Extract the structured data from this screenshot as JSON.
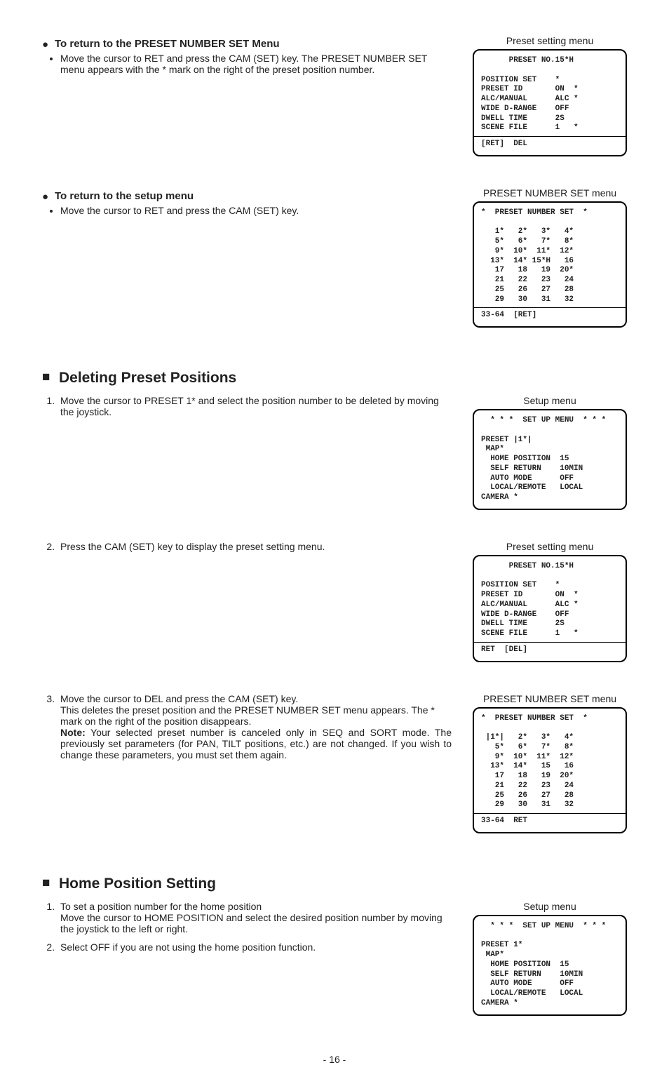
{
  "sections": {
    "return_preset": {
      "heading": "To return to the PRESET NUMBER SET Menu",
      "bullet": "Move the cursor to RET and press the CAM (SET) key. The PRESET NUMBER SET menu appears with the * mark on the right of the preset position number."
    },
    "return_setup": {
      "heading": "To return to the setup menu",
      "bullet": "Move the cursor to RET and press the CAM (SET) key."
    },
    "deleting": {
      "heading": "Deleting Preset Positions",
      "step1": "Move the cursor to PRESET 1* and select the position number to be deleted by moving the joystick.",
      "step2": "Press the CAM (SET) key to display the preset setting menu.",
      "step3a": "Move the cursor to DEL and press the CAM (SET) key.",
      "step3b": "This deletes the preset position and the PRESET NUMBER SET menu appears. The * mark on the right of the position disappears.",
      "note_label": "Note:",
      "note_text": " Your selected preset number is canceled only in SEQ and SORT mode.  The previously set parameters (for PAN, TILT positions, etc.) are not changed.  If you wish to change these parameters, you must set them again."
    },
    "home": {
      "heading": "Home Position Setting",
      "step1a": "To set a position number for the home position",
      "step1b": "Move the cursor to HOME POSITION and select the desired position number by moving the joystick to the left or right.",
      "step2": "Select OFF if you are not using the home position function."
    }
  },
  "panels": {
    "preset_setting_1": {
      "caption": "Preset setting menu",
      "title": "PRESET NO.15*H",
      "rows": [
        [
          "POSITION SET",
          "*"
        ],
        [
          "PRESET ID",
          "ON  *"
        ],
        [
          "ALC/MANUAL",
          "ALC *"
        ],
        [
          "WIDE D-RANGE",
          "OFF"
        ],
        [
          "DWELL TIME",
          "2S"
        ],
        [
          "SCENE FILE",
          "1   *"
        ]
      ],
      "footer": "[RET]  DEL"
    },
    "number_set_1": {
      "caption": "PRESET NUMBER SET menu",
      "title": "*  PRESET NUMBER SET  *",
      "grid": [
        [
          " 1*",
          " 2*",
          " 3*",
          " 4*"
        ],
        [
          " 5*",
          " 6*",
          " 7*",
          " 8*"
        ],
        [
          " 9*",
          "10*",
          "11*",
          "12*"
        ],
        [
          "13*",
          "14*",
          "15*H",
          "16"
        ],
        [
          "17",
          "18",
          "19",
          "20*"
        ],
        [
          "21",
          "22",
          "23",
          "24"
        ],
        [
          "25",
          "26",
          "27",
          "28"
        ],
        [
          "29",
          "30",
          "31",
          "32"
        ]
      ],
      "footer": "33-64  [RET]"
    },
    "setup_1": {
      "caption": "Setup menu",
      "title": "* * *  SET UP MENU  * * *",
      "rows": [
        [
          "PRESET |1*|",
          ""
        ],
        [
          " MAP*",
          ""
        ],
        [
          "  HOME POSITION",
          "15"
        ],
        [
          "  SELF RETURN",
          "10MIN"
        ],
        [
          "  AUTO MODE",
          "OFF"
        ],
        [
          "  LOCAL/REMOTE",
          "LOCAL"
        ],
        [
          "CAMERA *",
          ""
        ]
      ]
    },
    "preset_setting_2": {
      "caption": "Preset setting menu",
      "title": "PRESET NO.15*H",
      "rows": [
        [
          "POSITION SET",
          "*"
        ],
        [
          "PRESET ID",
          "ON  *"
        ],
        [
          "ALC/MANUAL",
          "ALC *"
        ],
        [
          "WIDE D-RANGE",
          "OFF"
        ],
        [
          "DWELL TIME",
          "2S"
        ],
        [
          "SCENE FILE",
          "1   *"
        ]
      ],
      "footer": "RET  [DEL]"
    },
    "number_set_2": {
      "caption": "PRESET NUMBER SET menu",
      "title": "*  PRESET NUMBER SET  *",
      "grid": [
        [
          "|1*|",
          " 2*",
          " 3*",
          " 4*"
        ],
        [
          " 5*",
          " 6*",
          " 7*",
          " 8*"
        ],
        [
          " 9*",
          "10*",
          "11*",
          "12*"
        ],
        [
          "13*",
          "14*",
          "15",
          "16"
        ],
        [
          "17",
          "18",
          "19",
          "20*"
        ],
        [
          "21",
          "22",
          "23",
          "24"
        ],
        [
          "25",
          "26",
          "27",
          "28"
        ],
        [
          "29",
          "30",
          "31",
          "32"
        ]
      ],
      "footer": "33-64  RET"
    },
    "setup_2": {
      "caption": "Setup menu",
      "title": "* * *  SET UP MENU  * * *",
      "rows": [
        [
          "PRESET 1*",
          ""
        ],
        [
          " MAP*",
          ""
        ],
        [
          "  HOME POSITION",
          "15"
        ],
        [
          "  SELF RETURN",
          "10MIN"
        ],
        [
          "  AUTO MODE",
          "OFF"
        ],
        [
          "  LOCAL/REMOTE",
          "LOCAL"
        ],
        [
          "CAMERA *",
          ""
        ]
      ]
    }
  },
  "page_number": "- 16 -"
}
